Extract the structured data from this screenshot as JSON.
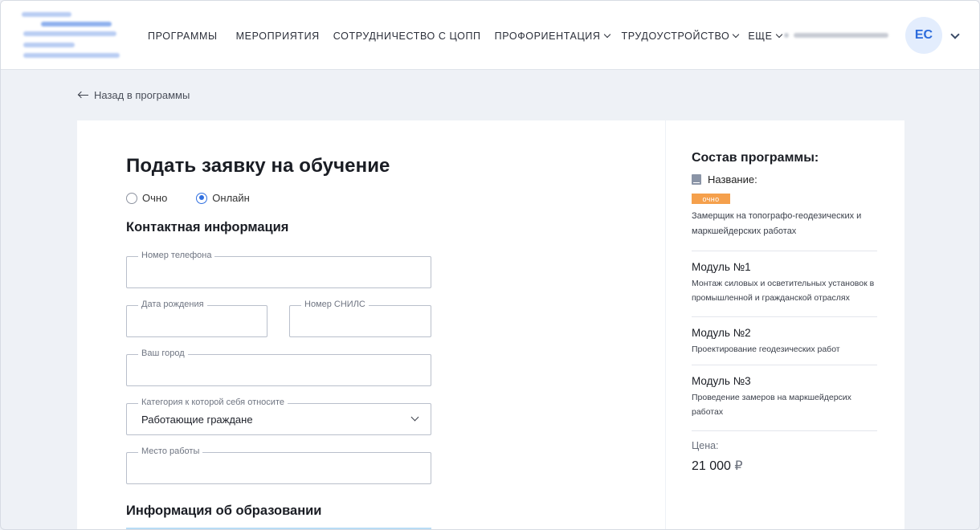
{
  "header": {
    "nav": [
      {
        "label": "ПРОГРАММЫ",
        "dropdown": false
      },
      {
        "label": "МЕРОПРИЯТИЯ",
        "dropdown": false
      },
      {
        "label": "СОТРУДНИЧЕСТВО С ЦОПП",
        "dropdown": false
      },
      {
        "label": "ПРОФОРИЕНТАЦИЯ",
        "dropdown": true
      },
      {
        "label": "ТРУДОУСТРОЙСТВО",
        "dropdown": true
      },
      {
        "label": "ЕЩЕ",
        "dropdown": true
      }
    ],
    "avatar_initials": "ЕС"
  },
  "back_link": "Назад в программы",
  "form": {
    "title": "Подать заявку на обучение",
    "format_options": [
      {
        "label": "Очно",
        "checked": false
      },
      {
        "label": "Онлайн",
        "checked": true
      }
    ],
    "contact_section": "Контактная информация",
    "fields": {
      "phone": {
        "label": "Номер телефона",
        "value": ""
      },
      "birth_date": {
        "label": "Дата рождения",
        "value": ""
      },
      "snils": {
        "label": "Номер СНИЛС",
        "value": ""
      },
      "city": {
        "label": "Ваш город",
        "value": ""
      },
      "category": {
        "label": "Категория к которой себя относите",
        "value": "Работающие граждане"
      },
      "workplace": {
        "label": "Место работы",
        "value": ""
      }
    },
    "education_section": "Информация об образовании"
  },
  "program": {
    "title": "Состав программы:",
    "name_label": "Название:",
    "badge": "очно",
    "description": "Замерщик на топографо-геодезических и маркшейдерских работах",
    "modules": [
      {
        "title": "Модуль №1",
        "description": "Монтаж силовых и осветительных установок в промышленной и гражданской отраслях"
      },
      {
        "title": "Модуль №2",
        "description": "Проектирование геодезических работ"
      },
      {
        "title": "Модуль №3",
        "description": "Проведение замеров на маркшейдерсих работах"
      }
    ],
    "price_label": "Цена:",
    "price_value": "21 000",
    "currency": "₽"
  },
  "colors": {
    "accent": "#2f6fe0",
    "badge": "#f5a04c",
    "background": "#eef1f6"
  }
}
